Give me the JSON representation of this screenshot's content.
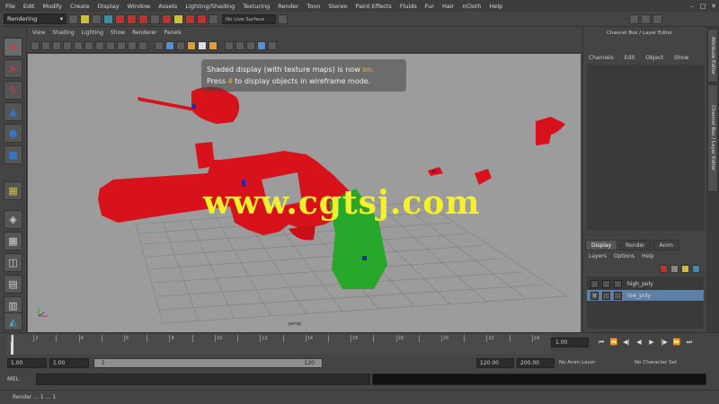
{
  "menus": [
    "File",
    "Edit",
    "Modify",
    "Create",
    "Display",
    "Window",
    "Assets",
    "Lighting/Shading",
    "Texturing",
    "Render",
    "Toon",
    "Stereo",
    "Paint Effects",
    "Fluids",
    "Fur",
    "Hair",
    "nCloth",
    "Help"
  ],
  "status_line": {
    "menu_set": "Rendering",
    "search_placeholder": "No Live Surface"
  },
  "panel_menus": [
    "View",
    "Shading",
    "Lighting",
    "Show",
    "Renderer",
    "Panels"
  ],
  "hud": {
    "line1_prefix": "Shaded display (with texture maps) is now ",
    "line1_highlight": "on.",
    "line2_prefix": "Press ",
    "line2_key": "4",
    "line2_suffix": " to display objects in wireframe mode."
  },
  "watermark": "www.cgtsj.com",
  "viewport_label": "persp",
  "channel_box": {
    "title": "Channel Box / Layer Editor",
    "menus": [
      "Channels",
      "Edit",
      "Object",
      "Show"
    ]
  },
  "layer_editor": {
    "tabs": [
      {
        "label": "Display",
        "active": true
      },
      {
        "label": "Render",
        "active": false
      },
      {
        "label": "Anim",
        "active": false
      }
    ],
    "menus": [
      "Layers",
      "Options",
      "Help"
    ],
    "layers": [
      {
        "visible": "",
        "name": "high_poly",
        "selected": false
      },
      {
        "visible": "V",
        "name": "low_poly",
        "selected": true
      }
    ]
  },
  "side_tabs": [
    "Attribute Editor",
    "Channel Box / Layer Editor"
  ],
  "time_slider": {
    "ticks": [
      1,
      2,
      3,
      4,
      5,
      6,
      7,
      8,
      9,
      10,
      11,
      12,
      13,
      14,
      15,
      16,
      17,
      18,
      19,
      20,
      21,
      22,
      23,
      24
    ],
    "current_frame": "1.00"
  },
  "range_slider": {
    "start": "1.00",
    "anim_start": "1.00",
    "range_start": "1",
    "range_end": "120",
    "range_end_field": "120.00",
    "anim_end": "200.00",
    "anim_layer": "No Anim Layer",
    "char_set": "No Character Set"
  },
  "command_line": {
    "mel_label": "MEL"
  },
  "help_line": "Render ... 1 ... 1"
}
